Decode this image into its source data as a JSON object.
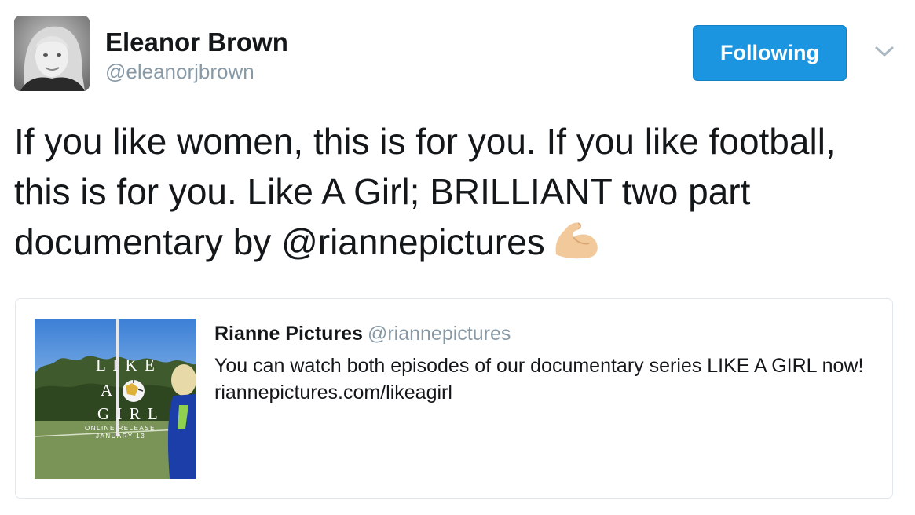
{
  "author": {
    "name": "Eleanor Brown",
    "handle": "@eleanorjbrown"
  },
  "follow_button": {
    "label": "Following",
    "color": "#1b95e0"
  },
  "menu": {
    "icon": "chevron-down-icon"
  },
  "tweet": {
    "text_before_mention": "If you like women, this is for you. If you like football, this is for you. Like A Girl; BRILLIANT two part documentary by ",
    "mention": "@riannepictures",
    "emoji": "flexed-biceps-emoji"
  },
  "quoted_tweet": {
    "name": "Rianne Pictures",
    "handle": "@riannepictures",
    "text": "You can watch both episodes of our documentary series LIKE A GIRL now! riannepictures.com/likeagirl",
    "thumbnail": {
      "title_lines": [
        "L I K E",
        "A",
        "G I R L"
      ],
      "release_line1": "ONLINE RELEASE",
      "release_line2": "JANUARY 13"
    }
  }
}
